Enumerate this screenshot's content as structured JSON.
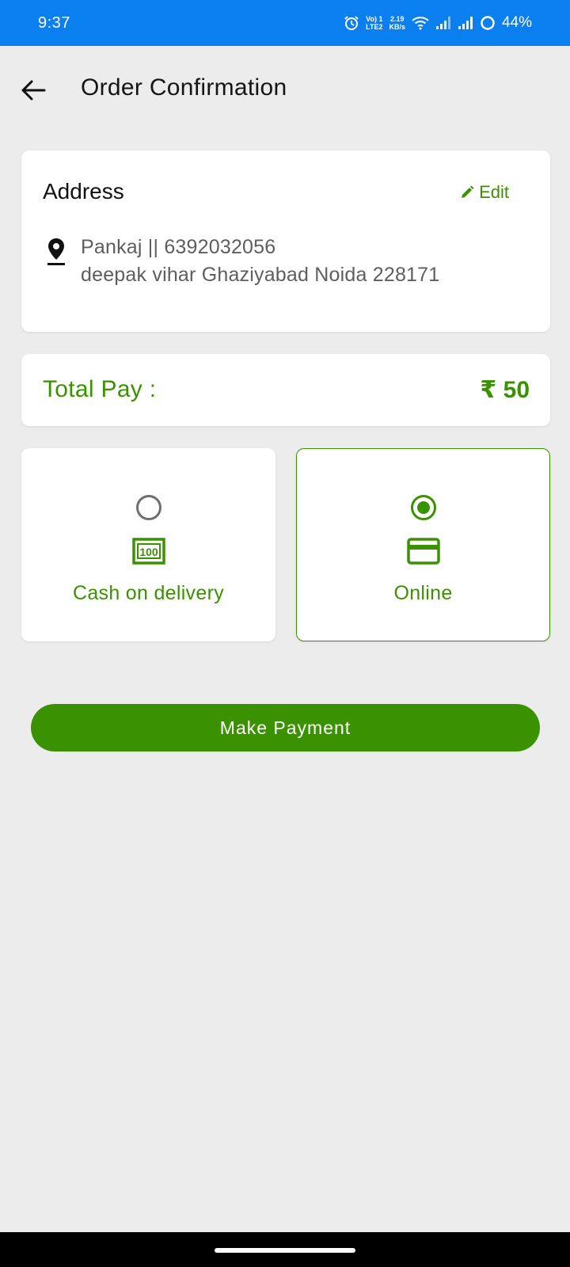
{
  "status_bar": {
    "time": "9:37",
    "volte_top": "Vo) 1",
    "volte_bottom": "LTE2",
    "speed_top": "2.19",
    "speed_bottom": "KB/s",
    "battery": "44%"
  },
  "header": {
    "title": "Order Confirmation",
    "back_icon": "arrow-left-icon"
  },
  "address": {
    "title": "Address",
    "edit_label": "Edit",
    "line1": "Pankaj || 6392032056",
    "line2": "deepak vihar Ghaziyabad Noida 228171"
  },
  "total": {
    "label": "Total Pay :",
    "value": "₹ 50"
  },
  "payment_options": [
    {
      "label": "Cash on delivery",
      "icon": "cash-icon",
      "selected": false
    },
    {
      "label": "Online",
      "icon": "credit-card-icon",
      "selected": true
    }
  ],
  "make_payment_label": "Make Payment",
  "colors": {
    "primary": "#3a9200",
    "status_bar": "#0a7ff0",
    "background": "#ececec"
  }
}
